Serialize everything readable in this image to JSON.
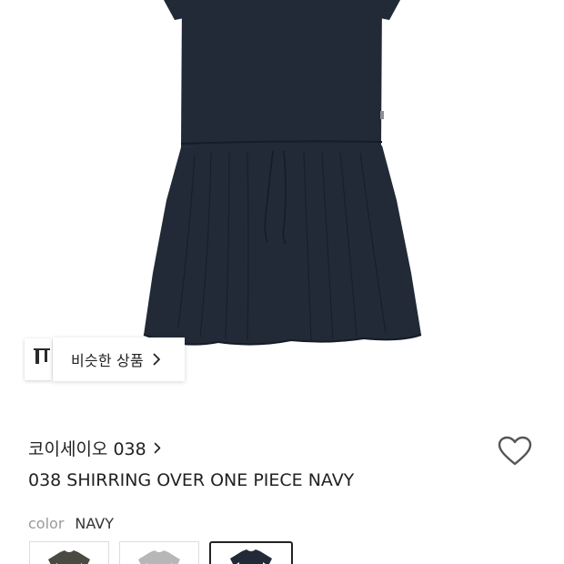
{
  "similar_products": {
    "label": "비슷한 상품"
  },
  "product": {
    "brand": "코이세이오 038",
    "title": "038 SHIRRING OVER ONE PIECE NAVY",
    "color_label": "color",
    "color_value": "NAVY",
    "dress_color": "#222a38",
    "variants": [
      {
        "color": "#4a4a42"
      },
      {
        "color": "#b7b7b7"
      },
      {
        "color": "#222a38",
        "selected": true
      }
    ]
  },
  "icons": {
    "wishlist": "heart-outline-icon",
    "similar_chevron": "chevron-right-icon",
    "brand_chevron": "chevron-right-icon"
  }
}
